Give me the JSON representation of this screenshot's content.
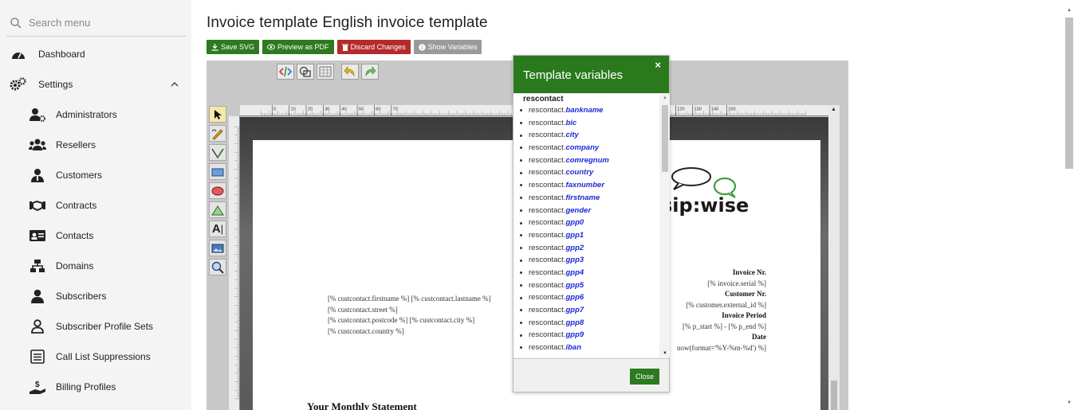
{
  "sidebar": {
    "search_placeholder": "Search menu",
    "items": [
      {
        "label": "Dashboard",
        "icon": "dashboard-icon"
      },
      {
        "label": "Settings",
        "icon": "gears-icon"
      },
      {
        "label": "Administrators",
        "icon": "user-cog-icon"
      },
      {
        "label": "Resellers",
        "icon": "users-icon"
      },
      {
        "label": "Customers",
        "icon": "user-tie-icon"
      },
      {
        "label": "Contracts",
        "icon": "handshake-icon"
      },
      {
        "label": "Contacts",
        "icon": "address-card-icon"
      },
      {
        "label": "Domains",
        "icon": "sitemap-icon"
      },
      {
        "label": "Subscribers",
        "icon": "user-icon"
      },
      {
        "label": "Subscriber Profile Sets",
        "icon": "user-outline-icon"
      },
      {
        "label": "Call List Suppressions",
        "icon": "list-icon"
      },
      {
        "label": "Billing Profiles",
        "icon": "hand-dollar-icon"
      }
    ]
  },
  "header": {
    "title": "Invoice template English invoice template"
  },
  "buttons": {
    "save_svg": "Save SVG",
    "preview_pdf": "Preview as PDF",
    "discard": "Discard Changes",
    "show_vars": "Show Variables"
  },
  "ruler": {
    "ticks": [
      "0",
      "10",
      "20",
      "30",
      "40",
      "50",
      "60",
      "70",
      "120",
      "130",
      "140",
      "150"
    ]
  },
  "document": {
    "addr_lines": [
      "[% custcontact.firstname %] [% custcontact.lastname %]",
      "[% custcontact.street %]",
      "[% custcontact.postcode %] [% custcontact.city %]",
      "[% custcontact.country %]"
    ],
    "invoice_nr_label": "Invoice Nr.",
    "invoice_nr_value": "[% invoice.serial %]",
    "customer_nr_label": "Customer Nr.",
    "customer_nr_value": "[% customer.external_id %]",
    "period_label": "Invoice Period",
    "period_value": "[% p_start %] - [% p_end %]",
    "date_label": "Date",
    "date_value": "now(format='%Y-%m-%d') %]",
    "statement": "Your Monthly Statement",
    "logo_text": "sip:wise"
  },
  "modal": {
    "title": "Template variables",
    "close_x": "×",
    "group": "rescontact",
    "prefix": "rescontact.",
    "fields": [
      "bankname",
      "bic",
      "city",
      "company",
      "comregnum",
      "country",
      "faxnumber",
      "firstname",
      "gender",
      "gpp0",
      "gpp1",
      "gpp2",
      "gpp3",
      "gpp4",
      "gpp5",
      "gpp6",
      "gpp7",
      "gpp8",
      "gpp9",
      "iban"
    ],
    "close_button": "Close"
  },
  "colors": {
    "green": "#2d7a1f",
    "red": "#b52a2a",
    "gray": "#9a9a9a",
    "field_blue": "#1c28d6"
  }
}
